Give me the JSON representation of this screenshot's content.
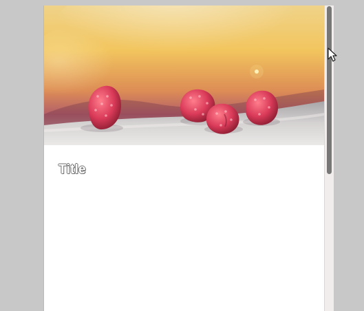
{
  "card": {
    "title": "Title"
  },
  "scrollbar": {
    "position_percent": 0
  }
}
